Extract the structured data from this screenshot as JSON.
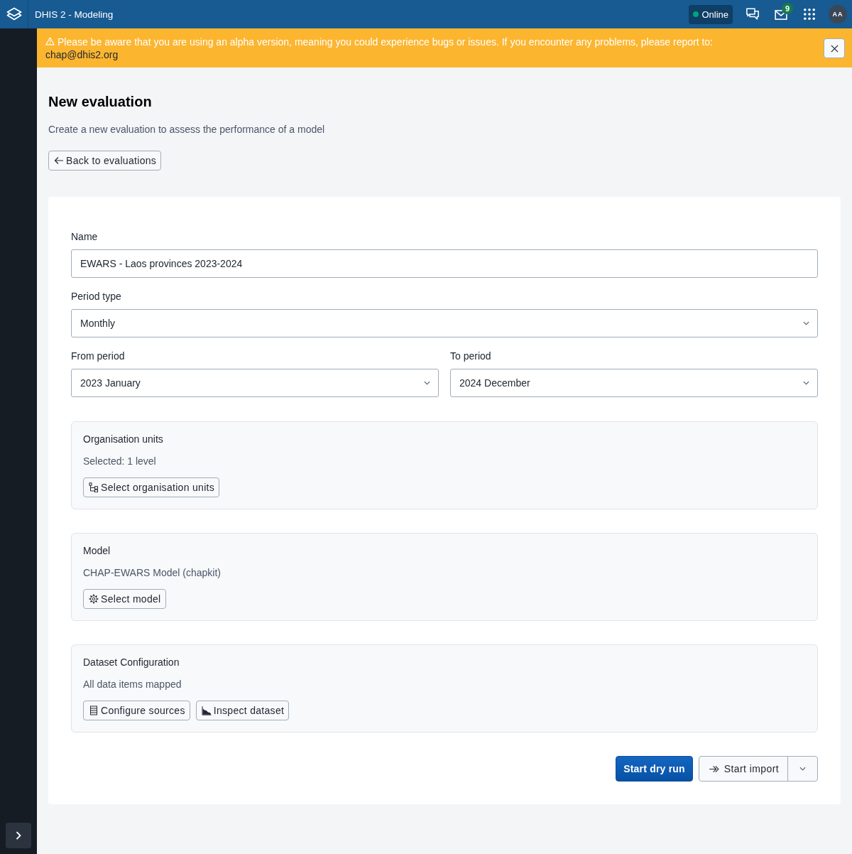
{
  "header": {
    "title": "DHIS 2 - Modeling",
    "status": {
      "label": "Online",
      "online": true
    },
    "messages_badge": "9",
    "user_initials": "AA"
  },
  "sidebar": {
    "expanded": false
  },
  "alert": {
    "message": "Please be aware that you are using an alpha version, meaning you could experience bugs or issues. If you encounter any problems, please report to:",
    "email": "chap@dhis2.org"
  },
  "page": {
    "title": "New evaluation",
    "description": "Create a new evaluation to assess the performance of a model",
    "back_button": "Back to evaluations"
  },
  "form": {
    "rows": [
      [
        {
          "kind": "text",
          "label": "Name",
          "value": "EWARS - Laos provinces 2023-2024"
        }
      ],
      [
        {
          "kind": "select",
          "label": "Period type",
          "value": "Monthly"
        }
      ],
      [
        {
          "kind": "select",
          "label": "From period",
          "value": "2023 January"
        },
        {
          "kind": "select",
          "label": "To period",
          "value": "2024 December"
        }
      ]
    ],
    "sections": [
      {
        "title": "Organisation units",
        "summary": "Selected: 1 level",
        "buttons": [
          {
            "kind": "org_units",
            "label": "Select organisation units"
          }
        ]
      },
      {
        "title": "Model",
        "summary": "CHAP-EWARS Model (chapkit)",
        "buttons": [
          {
            "kind": "model",
            "label": "Select model"
          }
        ]
      },
      {
        "title": "Dataset Configuration",
        "summary": "All data items mapped",
        "buttons": [
          {
            "kind": "sources",
            "label": "Configure sources"
          },
          {
            "kind": "inspect",
            "label": "Inspect dataset"
          }
        ]
      }
    ]
  },
  "actions": {
    "primary": "Start dry run",
    "secondary": "Start import"
  }
}
